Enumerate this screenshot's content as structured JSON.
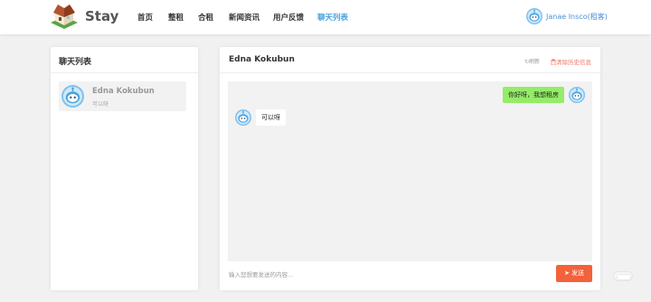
{
  "header": {
    "logo_text": "Stay",
    "nav": [
      {
        "label": "首页",
        "active": false
      },
      {
        "label": "整租",
        "active": false
      },
      {
        "label": "合租",
        "active": false
      },
      {
        "label": "新闻资讯",
        "active": false
      },
      {
        "label": "用户反馈",
        "active": false
      },
      {
        "label": "聊天列表",
        "active": true
      }
    ],
    "user_name": "Janae Insco(租客)"
  },
  "sidebar": {
    "title": "聊天列表",
    "items": [
      {
        "name": "Edna Kokubun",
        "last_message": "可以呀"
      }
    ]
  },
  "chat": {
    "title": "Edna Kokubun",
    "refresh_label": "刷新",
    "clear_label": "清除历史信息",
    "messages": [
      {
        "direction": "outgoing",
        "text": "你好呀，我想租房"
      },
      {
        "direction": "incoming",
        "text": "可以呀"
      }
    ],
    "input_value": "",
    "input_placeholder": "输入您想要发送的内容...",
    "send_label": "发送"
  },
  "icons": {
    "logo": "house-icon",
    "avatar": "robot-avatar-icon",
    "refresh": "refresh-icon",
    "delete": "trash-icon",
    "send": "paper-plane-icon"
  },
  "colors": {
    "accent": "#4aa3e0",
    "danger": "#f0776a",
    "send_button": "#f4613a",
    "outgoing_bubble": "#95ec69"
  }
}
